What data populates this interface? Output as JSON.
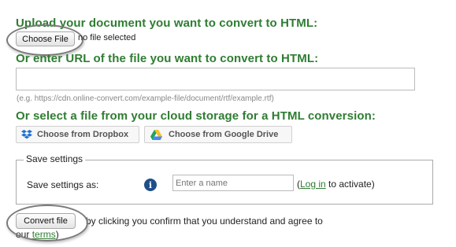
{
  "upload": {
    "heading": "Upload your document you want to convert to HTML:",
    "choose_file_label": "Choose File",
    "file_status": "no file selected"
  },
  "url": {
    "heading": "Or enter URL of the file you want to convert to HTML:",
    "value": "",
    "example": "(e.g. https://cdn.online-convert.com/example-file/document/rtf/example.rtf)"
  },
  "cloud": {
    "heading": "Or select a file from your cloud storage for a HTML conversion:",
    "dropbox_label": "Choose from Dropbox",
    "gdrive_label": "Choose from Google Drive"
  },
  "settings": {
    "legend": "Save settings",
    "label": "Save settings as:",
    "name_placeholder": "Enter a name",
    "paren_open": "(",
    "login_link": "Log in",
    "activate_text": " to activate)"
  },
  "convert": {
    "button_label": "Convert file",
    "terms_line1": "by clicking you confirm that you understand and agree to",
    "terms_prefix": "our ",
    "terms_link": "terms",
    "terms_suffix": ")"
  },
  "colors": {
    "heading_green": "#2f7d32",
    "info_blue": "#1f4f8a"
  }
}
